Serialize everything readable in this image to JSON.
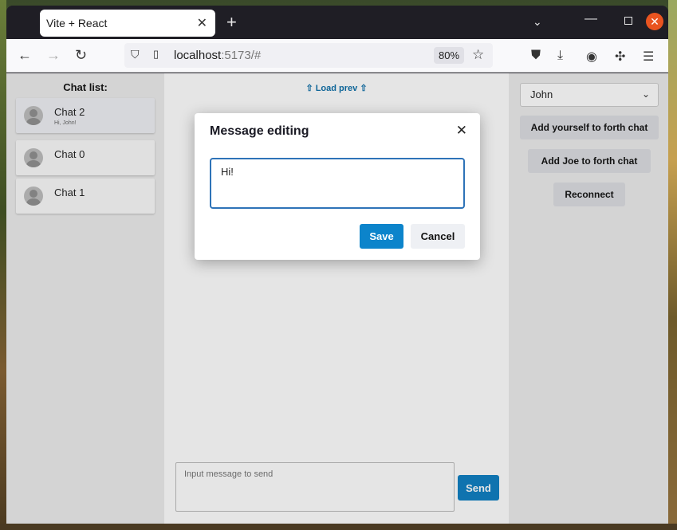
{
  "browser": {
    "tab_title": "Vite + React",
    "tab_close_icon": "✕",
    "new_tab_icon": "+",
    "url_host": "localhost",
    "url_rest": ":5173/#",
    "zoom": "80%"
  },
  "app": {
    "chat_list_title": "Chat list:",
    "chats": [
      {
        "name": "Chat 2",
        "preview": "Hi, John!"
      },
      {
        "name": "Chat 0",
        "preview": ""
      },
      {
        "name": "Chat 1",
        "preview": ""
      }
    ],
    "load_prev": "⇧ Load prev ⇧",
    "message_placeholder": "Input message to send",
    "send_label": "Send",
    "user_select": "John",
    "buttons": {
      "add_yourself": "Add yourself to forth chat",
      "add_joe": "Add Joe to forth chat",
      "reconnect": "Reconnect"
    }
  },
  "dialog": {
    "title": "Message editing",
    "text": "Hi!",
    "save_label": "Save",
    "cancel_label": "Cancel"
  },
  "colors": {
    "accent": "#0c84cb",
    "dialog_border": "#2e73b8",
    "window_close": "#e95420"
  }
}
